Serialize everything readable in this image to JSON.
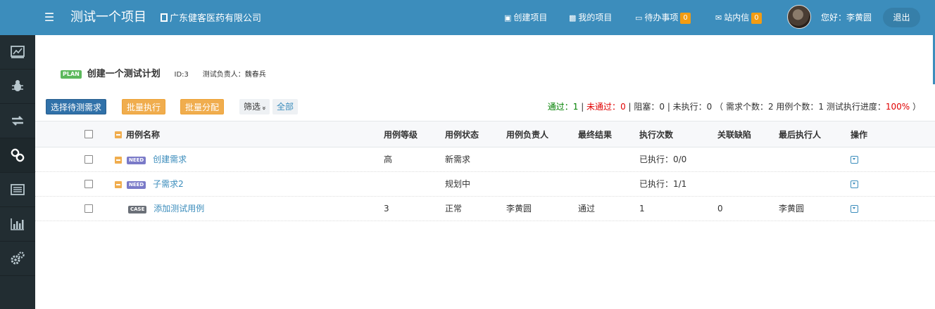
{
  "header": {
    "menu_icon": "hamburger-icon",
    "project_title": "测试一个项目",
    "company_name": "广东健客医药有限公司",
    "nav": {
      "create_project": "创建项目",
      "my_projects": "我的项目",
      "todo": "待办事项",
      "todo_count": "0",
      "messages": "站内信",
      "messages_count": "0"
    },
    "greeting": "您好：李黄圆",
    "logout": "退出"
  },
  "sidebar": {
    "items": [
      {
        "icon": "dashboard-icon"
      },
      {
        "icon": "bug-icon"
      },
      {
        "icon": "exchange-icon"
      },
      {
        "icon": "link-icon",
        "active": true
      },
      {
        "icon": "list-icon"
      },
      {
        "icon": "bar-chart-icon"
      },
      {
        "icon": "settings-icon"
      }
    ]
  },
  "plan": {
    "tag": "PLAN",
    "name": "创建一个测试计划",
    "id_text": "ID:3",
    "owner_text": "测试负责人：魏春兵"
  },
  "toolbar": {
    "select_requirements": "选择待测需求",
    "batch_execute": "批量执行",
    "batch_assign": "批量分配",
    "filter": "筛选",
    "filter_chevron": "»",
    "all": "全部"
  },
  "stats": {
    "pass_label": "通过：",
    "pass_value": "1",
    "fail_label": "未通过：",
    "fail_value": "0",
    "blocked_text": " | 阻塞：0 | 未执行：0 （ 需求个数：2  用例个数：1  测试执行进度：",
    "progress": "100%",
    "close": " ）",
    "sep": " | ",
    "accent_pass": "#008000",
    "accent_fail": "#e00000"
  },
  "table": {
    "columns": [
      "用例名称",
      "用例等级",
      "用例状态",
      "用例负责人",
      "最终结果",
      "执行次数",
      "关联缺陷",
      "最后执行人",
      "操作"
    ],
    "rows": [
      {
        "tag": "NEED",
        "name": "创建需求",
        "level": "高",
        "status": "新需求",
        "owner": "",
        "result": "",
        "exec": "已执行：0/0",
        "defects": "",
        "last_exec": ""
      },
      {
        "tag": "NEED",
        "name": "子需求2",
        "level": "",
        "status": "规划中",
        "owner": "",
        "result": "",
        "exec": "已执行：1/1",
        "defects": "",
        "last_exec": ""
      },
      {
        "tag": "CASE",
        "name": "添加测试用例",
        "level": "3",
        "status": "正常",
        "owner": "李黄圆",
        "result": "通过",
        "exec": "1",
        "defects": "0",
        "last_exec": "李黄圆"
      }
    ]
  }
}
